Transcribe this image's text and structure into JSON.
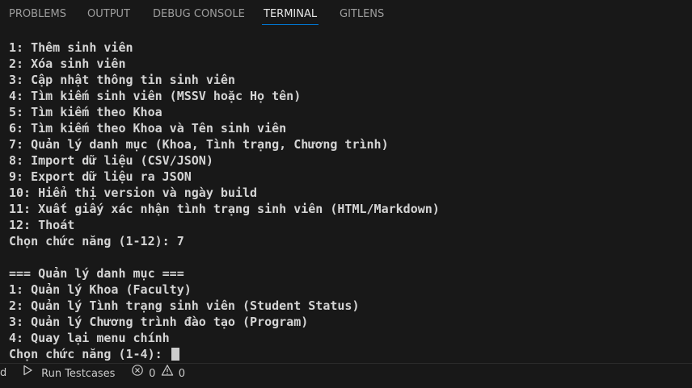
{
  "panel": {
    "tabs": [
      {
        "label": "PROBLEMS",
        "active": false
      },
      {
        "label": "OUTPUT",
        "active": false
      },
      {
        "label": "DEBUG CONSOLE",
        "active": false
      },
      {
        "label": "TERMINAL",
        "active": true
      },
      {
        "label": "GITLENS",
        "active": false
      }
    ],
    "accent_color": "#0078d4"
  },
  "terminal": {
    "lines": [
      "1: Thêm sinh viên",
      "2: Xóa sinh viên",
      "3: Cập nhật thông tin sinh viên",
      "4: Tìm kiếm sinh viên (MSSV hoặc Họ tên)",
      "5: Tìm kiếm theo Khoa",
      "6: Tìm kiếm theo Khoa và Tên sinh viên",
      "7: Quản lý danh mục (Khoa, Tình trạng, Chương trình)",
      "8: Import dữ liệu (CSV/JSON)",
      "9: Export dữ liệu ra JSON",
      "10: Hiển thị version và ngày build",
      "11: Xuất giấy xác nhận tình trạng sinh viên (HTML/Markdown)",
      "12: Thoát",
      "Chọn chức năng (1-12): 7",
      "",
      "=== Quản lý danh mục ===",
      "1: Quản lý Khoa (Faculty)",
      "2: Quản lý Tình trạng sinh viên (Student Status)",
      "3: Quản lý Chương trình đào tạo (Program)",
      "4: Quay lại menu chính"
    ],
    "prompt": "Chọn chức năng (1-4): "
  },
  "statusbar": {
    "left_fragment": "d",
    "run_testcases_label": "Run Testcases",
    "run_icon": "play-icon",
    "errors_count": "0",
    "warnings_count": "0",
    "error_icon": "error-circle-icon",
    "warning_icon": "warning-triangle-icon"
  }
}
